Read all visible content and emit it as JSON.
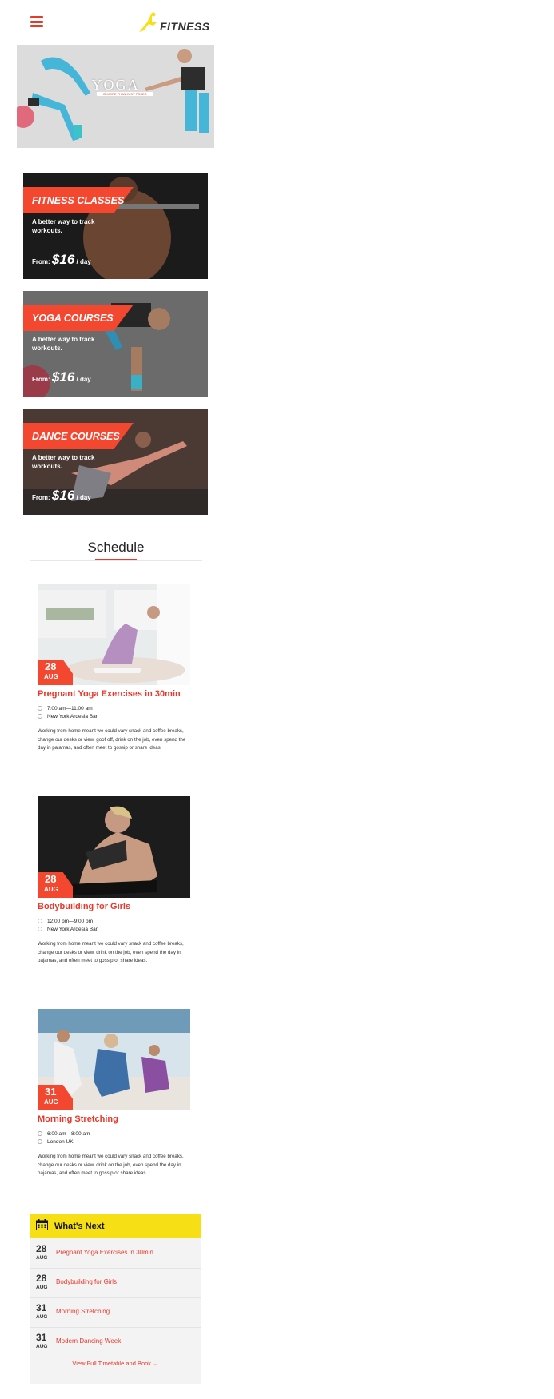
{
  "header": {
    "menu_icon": "hamburger-menu-icon",
    "logo_text": "FITNESS",
    "logo_icon": "runner-logo-icon"
  },
  "hero": {
    "title": "YOGA",
    "tagline": "IS MORE THAN JUST POSES",
    "description": "",
    "time": ""
  },
  "courses": [
    {
      "name": "FITNESS CLASSES",
      "tagline": "A better way to track workouts.",
      "price_prefix": "From:",
      "price": "$16",
      "price_unit": "/ day"
    },
    {
      "name": "YOGA COURSES",
      "tagline": "A better way to track workouts.",
      "price_prefix": "From:",
      "price": "$16",
      "price_unit": "/ day"
    },
    {
      "name": "DANCE COURSES",
      "tagline": "A better way to track workouts.",
      "price_prefix": "From:",
      "price": "$16",
      "price_unit": "/ day"
    }
  ],
  "schedule": {
    "title": "Schedule",
    "events": [
      {
        "day": "28",
        "month": "AUG",
        "title": "Pregnant Yoga Exercises in 30min",
        "time": "7:00 am—11:00 am",
        "location": "New York Ardesia Bar",
        "description": "Working from home meant we could vary snack and coffee breaks, change our desks or view, goof off, drink on the job, even spend the day in pajamas, and often meet to gossip or share ideas"
      },
      {
        "day": "28",
        "month": "AUG",
        "title": "Bodybuilding for Girls",
        "time": "12:00 pm—9:00 pm",
        "location": "New York Ardesia Bar",
        "description": "Working from home meant we could vary snack and coffee breaks, change our desks or view, drink on the job, even spend the day in pajamas, and often meet to gossip or share ideas."
      },
      {
        "day": "31",
        "month": "AUG",
        "title": "Morning Stretching",
        "time": "6:00 am—8:00 am",
        "location": "London UK",
        "description": "Working from home meant we could vary snack and coffee breaks, change our desks or view, drink on the job, even spend the day in pajamas, and often meet to gossip or share ideas."
      }
    ]
  },
  "whats_next": {
    "title": "What's Next",
    "icon": "calendar-icon",
    "items": [
      {
        "day": "28",
        "month": "AUG",
        "label": "Pregnant Yoga Exercises in 30min"
      },
      {
        "day": "28",
        "month": "AUG",
        "label": "Bodybuilding for Girls"
      },
      {
        "day": "31",
        "month": "AUG",
        "label": "Morning Stretching"
      },
      {
        "day": "31",
        "month": "AUG",
        "label": "Modern Dancing Week"
      }
    ],
    "link": "View Full Timetable and Book →"
  },
  "colors": {
    "accent": "#f4472f",
    "highlight": "#f7df16",
    "text": "#222222"
  }
}
